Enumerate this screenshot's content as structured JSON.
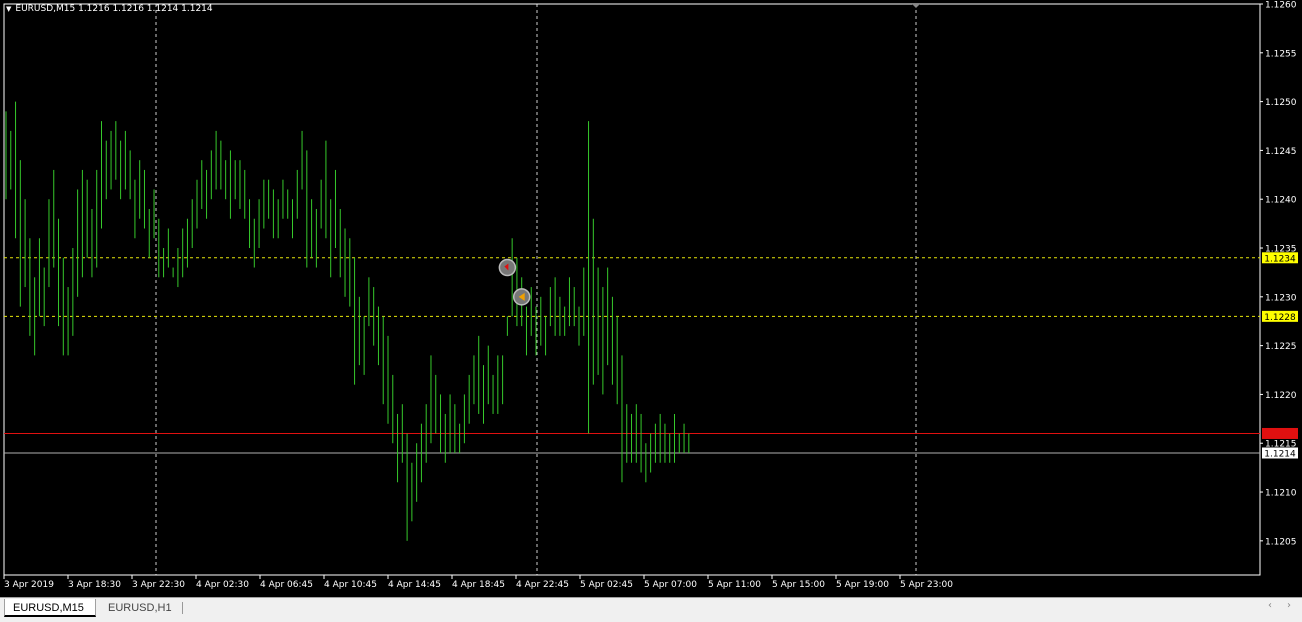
{
  "header": {
    "symbol_line": "EURUSD,M15  1.1216 1.1216 1.1214 1.1214",
    "menu_icon": "triangle-down-icon"
  },
  "tabs": [
    {
      "label": "EURUSD,M15",
      "active": true
    },
    {
      "label": "EURUSD,H1",
      "active": false
    }
  ],
  "scroll": {
    "left_icon": "chevron-left-icon",
    "right_icon": "chevron-right-icon",
    "left_glyph": "‹",
    "right_glyph": "›"
  },
  "colors": {
    "background": "#000000",
    "candle": "#36c92b",
    "grid": "#ffffff",
    "level_line": "#e6e60a",
    "bid_line": "#e01010",
    "ask_line": "#b0b0b0",
    "axis_text": "#ffffff"
  },
  "chart_data": {
    "type": "bar",
    "symbol": "EURUSD",
    "timeframe": "M15",
    "ylim": [
      1.12015,
      1.126
    ],
    "y_ticks": [
      "1.1205",
      "1.1210",
      "1.1215",
      "1.1220",
      "1.1225",
      "1.1230",
      "1.1235",
      "1.1240",
      "1.1245",
      "1.1250",
      "1.1255",
      "1.1260"
    ],
    "x_ticks": [
      "3 Apr 2019",
      "3 Apr 18:30",
      "3 Apr 22:30",
      "4 Apr 02:30",
      "4 Apr 06:45",
      "4 Apr 10:45",
      "4 Apr 14:45",
      "4 Apr 18:45",
      "4 Apr 22:45",
      "5 Apr 02:45",
      "5 Apr 07:00",
      "5 Apr 11:00",
      "5 Apr 15:00",
      "5 Apr 19:00",
      "5 Apr 23:00"
    ],
    "vertical_grid_at": [
      "3 Apr 22:30",
      "4 Apr 22:45",
      "5 Apr 23:00"
    ],
    "horizontal_levels": [
      {
        "value": 1.1234,
        "label": "1.1234",
        "kind": "level"
      },
      {
        "value": 1.1228,
        "label": "1.1228",
        "kind": "level"
      },
      {
        "value": 1.1216,
        "label": "1.1216",
        "kind": "bid"
      },
      {
        "value": 1.1214,
        "label": "1.1214",
        "kind": "ask"
      }
    ],
    "trade_markers": [
      {
        "bar": 105,
        "price": 1.1233,
        "kind": "sell-arrow"
      },
      {
        "bar": 108,
        "price": 1.123,
        "kind": "buy-arrow"
      }
    ],
    "bars": [
      [
        1.1249,
        1.124
      ],
      [
        1.1247,
        1.1241
      ],
      [
        1.125,
        1.1236
      ],
      [
        1.1244,
        1.1229
      ],
      [
        1.124,
        1.1231
      ],
      [
        1.1236,
        1.1226
      ],
      [
        1.1232,
        1.1224
      ],
      [
        1.1236,
        1.1228
      ],
      [
        1.1233,
        1.1227
      ],
      [
        1.124,
        1.1231
      ],
      [
        1.1243,
        1.1233
      ],
      [
        1.1238,
        1.1227
      ],
      [
        1.1234,
        1.1224
      ],
      [
        1.1231,
        1.1224
      ],
      [
        1.1235,
        1.1226
      ],
      [
        1.1241,
        1.123
      ],
      [
        1.1243,
        1.1232
      ],
      [
        1.1242,
        1.1234
      ],
      [
        1.1239,
        1.1232
      ],
      [
        1.1243,
        1.1233
      ],
      [
        1.1248,
        1.1237
      ],
      [
        1.1246,
        1.124
      ],
      [
        1.1247,
        1.1241
      ],
      [
        1.1248,
        1.1242
      ],
      [
        1.1246,
        1.124
      ],
      [
        1.1247,
        1.1241
      ],
      [
        1.1245,
        1.124
      ],
      [
        1.1242,
        1.1236
      ],
      [
        1.1244,
        1.1238
      ],
      [
        1.1243,
        1.1237
      ],
      [
        1.1239,
        1.1234
      ],
      [
        1.1241,
        1.1236
      ],
      [
        1.1238,
        1.1232
      ],
      [
        1.1235,
        1.1232
      ],
      [
        1.1237,
        1.1233
      ],
      [
        1.1233,
        1.1232
      ],
      [
        1.1235,
        1.1231
      ],
      [
        1.1237,
        1.1232
      ],
      [
        1.1238,
        1.1233
      ],
      [
        1.124,
        1.1235
      ],
      [
        1.1242,
        1.1237
      ],
      [
        1.1244,
        1.1239
      ],
      [
        1.1243,
        1.1238
      ],
      [
        1.1245,
        1.124
      ],
      [
        1.1247,
        1.1241
      ],
      [
        1.1246,
        1.1241
      ],
      [
        1.1244,
        1.124
      ],
      [
        1.1245,
        1.1238
      ],
      [
        1.1244,
        1.124
      ],
      [
        1.1244,
        1.1239
      ],
      [
        1.1243,
        1.1238
      ],
      [
        1.124,
        1.1235
      ],
      [
        1.1238,
        1.1233
      ],
      [
        1.124,
        1.1235
      ],
      [
        1.1242,
        1.1237
      ],
      [
        1.1242,
        1.1238
      ],
      [
        1.1241,
        1.1236
      ],
      [
        1.124,
        1.1236
      ],
      [
        1.1242,
        1.1238
      ],
      [
        1.1241,
        1.1238
      ],
      [
        1.124,
        1.1236
      ],
      [
        1.1243,
        1.1238
      ],
      [
        1.1247,
        1.1241
      ],
      [
        1.1245,
        1.1233
      ],
      [
        1.124,
        1.1234
      ],
      [
        1.1239,
        1.1233
      ],
      [
        1.1242,
        1.1237
      ],
      [
        1.1246,
        1.1236
      ],
      [
        1.124,
        1.1232
      ],
      [
        1.1243,
        1.1235
      ],
      [
        1.1239,
        1.1232
      ],
      [
        1.1237,
        1.123
      ],
      [
        1.1236,
        1.1229
      ],
      [
        1.1234,
        1.1221
      ],
      [
        1.123,
        1.1223
      ],
      [
        1.1228,
        1.1222
      ],
      [
        1.1232,
        1.1227
      ],
      [
        1.1231,
        1.1225
      ],
      [
        1.1229,
        1.1223
      ],
      [
        1.1228,
        1.1219
      ],
      [
        1.1226,
        1.1217
      ],
      [
        1.1222,
        1.1215
      ],
      [
        1.1218,
        1.1211
      ],
      [
        1.1219,
        1.1213
      ],
      [
        1.1216,
        1.1205
      ],
      [
        1.1213,
        1.1207
      ],
      [
        1.1215,
        1.1209
      ],
      [
        1.1217,
        1.1211
      ],
      [
        1.1219,
        1.1213
      ],
      [
        1.1224,
        1.1215
      ],
      [
        1.1222,
        1.1216
      ],
      [
        1.122,
        1.1214
      ],
      [
        1.1218,
        1.1213
      ],
      [
        1.122,
        1.1214
      ],
      [
        1.1219,
        1.1214
      ],
      [
        1.1217,
        1.1214
      ],
      [
        1.122,
        1.1215
      ],
      [
        1.1222,
        1.1217
      ],
      [
        1.1224,
        1.1219
      ],
      [
        1.1226,
        1.1218
      ],
      [
        1.1223,
        1.1217
      ],
      [
        1.1225,
        1.1219
      ],
      [
        1.1222,
        1.1218
      ],
      [
        1.1224,
        1.1218
      ],
      [
        1.1224,
        1.1219
      ],
      [
        1.1228,
        1.1226
      ],
      [
        1.1236,
        1.1228
      ],
      [
        1.1234,
        1.1227
      ],
      [
        1.1232,
        1.1227
      ],
      [
        1.1229,
        1.1224
      ],
      [
        1.1231,
        1.1226
      ],
      [
        1.1229,
        1.1224
      ],
      [
        1.123,
        1.1225
      ],
      [
        1.1228,
        1.1224
      ],
      [
        1.1231,
        1.1227
      ],
      [
        1.1232,
        1.1226
      ],
      [
        1.123,
        1.1226
      ],
      [
        1.1229,
        1.1226
      ],
      [
        1.1232,
        1.1227
      ],
      [
        1.1231,
        1.1227
      ],
      [
        1.1229,
        1.1225
      ],
      [
        1.1233,
        1.1226
      ],
      [
        1.1248,
        1.1216
      ],
      [
        1.1238,
        1.1221
      ],
      [
        1.1233,
        1.1222
      ],
      [
        1.1231,
        1.122
      ],
      [
        1.1233,
        1.1223
      ],
      [
        1.123,
        1.1221
      ],
      [
        1.1228,
        1.1219
      ],
      [
        1.1224,
        1.1211
      ],
      [
        1.1219,
        1.1213
      ],
      [
        1.1218,
        1.1213
      ],
      [
        1.1219,
        1.1213
      ],
      [
        1.1218,
        1.1212
      ],
      [
        1.1215,
        1.1211
      ],
      [
        1.1216,
        1.1212
      ],
      [
        1.1217,
        1.1213
      ],
      [
        1.1218,
        1.1213
      ],
      [
        1.1217,
        1.1213
      ],
      [
        1.1216,
        1.1213
      ],
      [
        1.1218,
        1.1213
      ],
      [
        1.1216,
        1.1214
      ],
      [
        1.1217,
        1.1214
      ],
      [
        1.1216,
        1.1214
      ]
    ]
  }
}
